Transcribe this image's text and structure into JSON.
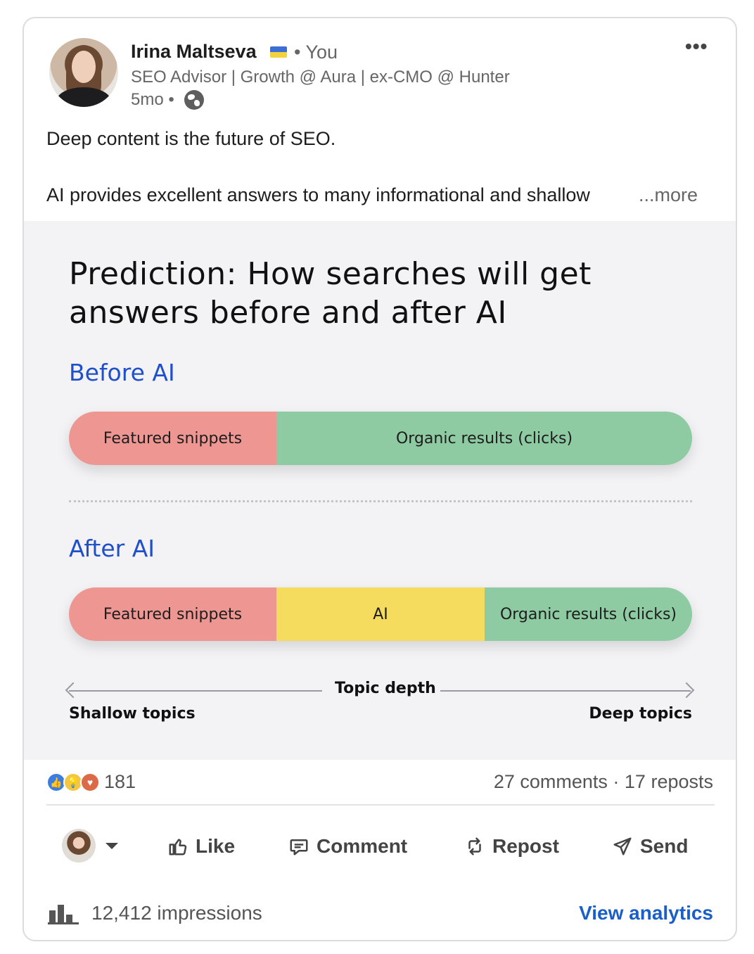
{
  "author": {
    "name": "Irina Maltseva",
    "relation": "• You",
    "headline": "SEO Advisor | Growth @ Aura | ex-CMO @ Hunter",
    "time": "5mo •"
  },
  "post": {
    "line1": "Deep content is the future of SEO.",
    "line2": "AI provides excellent answers to many informational and shallow",
    "see_more": "...more",
    "menu": "•••"
  },
  "graphic": {
    "title": "Prediction: How searches will get answers before and after AI",
    "before": {
      "heading": "Before AI",
      "segments": [
        {
          "label": "Featured snippets",
          "share": 0.333
        },
        {
          "label": "Organic results (clicks)",
          "share": 0.667
        }
      ]
    },
    "after": {
      "heading": "After AI",
      "segments": [
        {
          "label": "Featured snippets",
          "share": 0.333
        },
        {
          "label": "AI",
          "share": 0.334
        },
        {
          "label": "Organic results (clicks)",
          "share": 0.333
        }
      ]
    },
    "axis": {
      "center": "Topic depth",
      "left": "Shallow topics",
      "right": "Deep topics"
    },
    "colors": {
      "snippets": "#ee9792",
      "ai": "#f6dc5e",
      "organic": "#8ecba2",
      "heading": "#1f4fc9"
    }
  },
  "social": {
    "reaction_count": "181",
    "comments_reposts": "27 comments · 17 reposts"
  },
  "actions": {
    "like": "Like",
    "comment": "Comment",
    "repost": "Repost",
    "send": "Send"
  },
  "analytics": {
    "impressions": "12,412 impressions",
    "view_link": "View analytics"
  }
}
